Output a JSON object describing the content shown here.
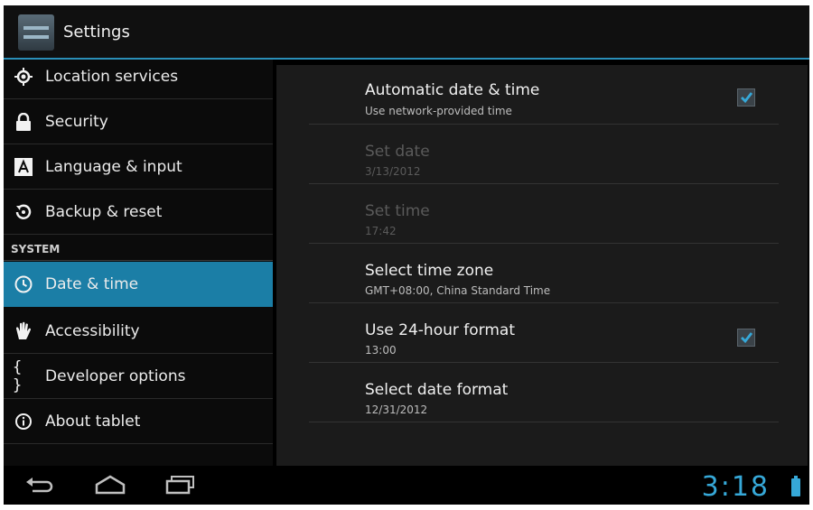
{
  "actionbar": {
    "title": "Settings",
    "icon": "settings-app-icon"
  },
  "sidebar": {
    "items": [
      {
        "label": "Location services",
        "icon": "location-icon"
      },
      {
        "label": "Security",
        "icon": "lock-icon"
      },
      {
        "label": "Language & input",
        "icon": "keyboard-letter-icon"
      },
      {
        "label": "Backup & reset",
        "icon": "backup-icon"
      },
      {
        "label": "Date & time",
        "icon": "clock-icon",
        "selected": true
      },
      {
        "label": "Accessibility",
        "icon": "hand-icon"
      },
      {
        "label": "Developer options",
        "icon": "braces-icon"
      },
      {
        "label": "About tablet",
        "icon": "info-icon"
      }
    ],
    "section_system": "SYSTEM"
  },
  "prefs": [
    {
      "title": "Automatic date & time",
      "summary": "Use network-provided time",
      "checked": true
    },
    {
      "title": "Set date",
      "summary": "3/13/2012",
      "disabled": true
    },
    {
      "title": "Set time",
      "summary": "17:42",
      "disabled": true
    },
    {
      "title": "Select time zone",
      "summary": "GMT+08:00, China Standard Time"
    },
    {
      "title": "Use 24-hour format",
      "summary": "13:00",
      "checked": true
    },
    {
      "title": "Select date format",
      "summary": "12/31/2012"
    }
  ],
  "statusbar": {
    "clock": "3:18"
  },
  "colors": {
    "accent": "#1b7ea6",
    "clock": "#36a8d8"
  }
}
